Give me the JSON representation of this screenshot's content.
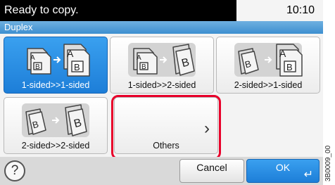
{
  "status_bar": {
    "message": "Ready to copy.",
    "time": "10:10"
  },
  "title": "Duplex",
  "options": [
    {
      "label": "1-sided>>1-sided",
      "selected": true
    },
    {
      "label": "1-sided>>2-sided",
      "selected": false
    },
    {
      "label": "2-sided>>1-sided",
      "selected": false
    },
    {
      "label": "2-sided>>2-sided",
      "selected": false
    },
    {
      "label": "Others",
      "selected": false,
      "highlighted": true
    }
  ],
  "buttons": {
    "help": "?",
    "cancel": "Cancel",
    "ok": "OK"
  },
  "doc_id": "3B0009_00",
  "colors": {
    "accent": "#1d7ed8",
    "highlight": "#e8002a"
  }
}
